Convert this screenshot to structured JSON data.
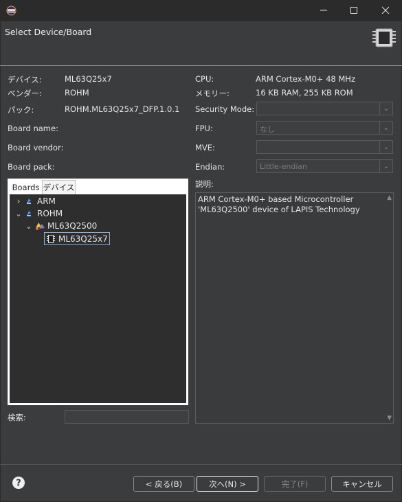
{
  "header": {
    "title": "Select Device/Board"
  },
  "left": {
    "device_label": "デバイス:",
    "device_value": "ML63Q25x7",
    "vendor_label": "ベンダー:",
    "vendor_value": "ROHM",
    "pack_label": "パック:",
    "pack_value": "ROHM.ML63Q25x7_DFP.1.0.1",
    "board_name_label": "Board name:",
    "board_vendor_label": "Board vendor:",
    "board_pack_label": "Board pack:"
  },
  "right": {
    "cpu_label": "CPU:",
    "cpu_value": "ARM Cortex-M0+ 48 MHz",
    "memory_label": "メモリー:",
    "memory_value": "16 KB RAM, 255 KB ROM",
    "security_label": "Security Mode:",
    "fpu_label": "FPU:",
    "fpu_value": "なし",
    "mve_label": "MVE:",
    "endian_label": "Endian:",
    "endian_value": "Little-endian",
    "description_label": "説明:",
    "description_line1": "ARM Cortex-M0+ based Microcontroller",
    "description_line2": "'ML63Q2500' device of LAPIS Technology"
  },
  "tabs": {
    "boards": "Boards",
    "devices": "デバイス"
  },
  "tree": {
    "arm": "ARM",
    "rohm": "ROHM",
    "family": "ML63Q2500",
    "device": "ML63Q25x7"
  },
  "search": {
    "label": "検索:",
    "value": ""
  },
  "buttons": {
    "back": "< 戻る(B)",
    "next": "次へ(N) >",
    "finish": "完了(F)",
    "cancel": "キャンセル"
  }
}
